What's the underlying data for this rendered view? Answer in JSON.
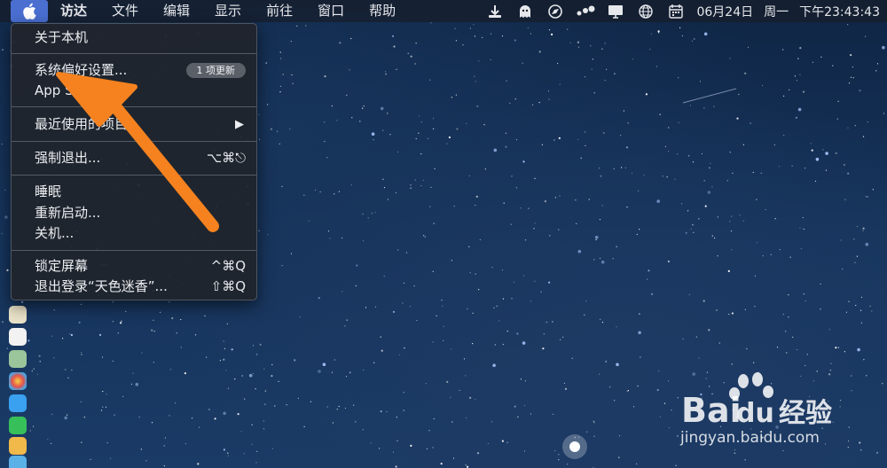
{
  "menubar": {
    "menus": [
      "访达",
      "文件",
      "编辑",
      "显示",
      "前往",
      "窗口",
      "帮助"
    ],
    "status_icons": [
      "download-icon",
      "ghost-icon",
      "compass-icon",
      "dots-icon",
      "display-icon",
      "globe-icon",
      "calendar-icon"
    ],
    "date": "06月24日",
    "weekday": "周一",
    "time": "下午23:43:43"
  },
  "apple_menu": {
    "about": "关于本机",
    "system_prefs": "系统偏好设置...",
    "update_badge": "1 项更新",
    "app_store": "App Store...",
    "recent_items": "最近使用的项目",
    "force_quit": "强制退出...",
    "force_quit_shortcut": "⌥⌘⎋",
    "sleep": "睡眠",
    "restart": "重新启动...",
    "shutdown": "关机...",
    "lock_screen": "锁定屏幕",
    "lock_screen_shortcut": "^⌘Q",
    "logout": "退出登录“天色迷香”...",
    "logout_shortcut": "⇧⌘Q"
  },
  "watermark": {
    "brand_bai": "Bai",
    "brand_du": "du",
    "brand_jingyan": "经验",
    "url": "jingyan.baidu.com"
  },
  "colors": {
    "accent": "#4a6fd1",
    "arrow": "#f5821f"
  }
}
